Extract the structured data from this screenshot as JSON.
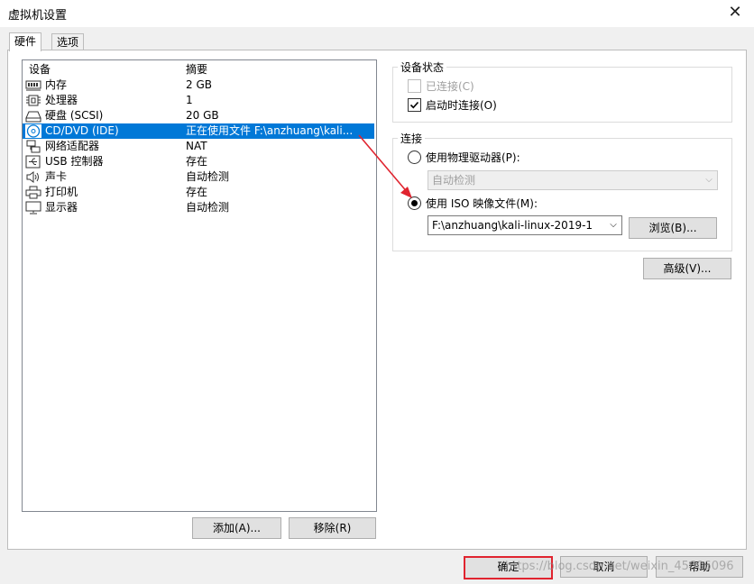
{
  "window": {
    "title": "虚拟机设置",
    "close_glyph": "✕"
  },
  "tabs": [
    {
      "label": "硬件"
    },
    {
      "label": "选项"
    }
  ],
  "device_list": {
    "headers": {
      "device": "设备",
      "summary": "摘要"
    },
    "rows": [
      {
        "icon": "memory-icon",
        "device": "内存",
        "summary": "2 GB"
      },
      {
        "icon": "cpu-icon",
        "device": "处理器",
        "summary": "1"
      },
      {
        "icon": "harddisk-icon",
        "device": "硬盘 (SCSI)",
        "summary": "20 GB"
      },
      {
        "icon": "cd-dvd-icon",
        "device": "CD/DVD (IDE)",
        "summary": "正在使用文件 F:\\anzhuang\\kali...",
        "selected": true
      },
      {
        "icon": "network-icon",
        "device": "网络适配器",
        "summary": "NAT"
      },
      {
        "icon": "usb-icon",
        "device": "USB 控制器",
        "summary": "存在"
      },
      {
        "icon": "speaker-icon",
        "device": "声卡",
        "summary": "自动检测"
      },
      {
        "icon": "printer-icon",
        "device": "打印机",
        "summary": "存在"
      },
      {
        "icon": "monitor-icon",
        "device": "显示器",
        "summary": "自动检测"
      }
    ]
  },
  "left_buttons": {
    "add": "添加(A)...",
    "remove": "移除(R)"
  },
  "device_status": {
    "label": "设备状态",
    "connected": {
      "label": "已连接(C)",
      "checked": false,
      "disabled": true
    },
    "connect_at_power_on": {
      "label": "启动时连接(O)",
      "checked": true
    }
  },
  "connection": {
    "label": "连接",
    "physical_drive": {
      "label": "使用物理驱动器(P):",
      "selected": false
    },
    "physical_drive_combo": {
      "value": "自动检测",
      "disabled": true
    },
    "iso_image": {
      "label": "使用 ISO 映像文件(M):",
      "selected": true
    },
    "iso_path": {
      "value": "F:\\anzhuang\\kali-linux-2019-1"
    },
    "browse_button": "浏览(B)..."
  },
  "advanced_button": "高级(V)...",
  "footer_buttons": {
    "ok": "确定",
    "cancel": "取消",
    "help": "帮助"
  },
  "watermark": "https://blog.csdn.net/weixin_45606096",
  "colors": {
    "selection": "#0078d7",
    "annotation_red": "#e0242f"
  }
}
